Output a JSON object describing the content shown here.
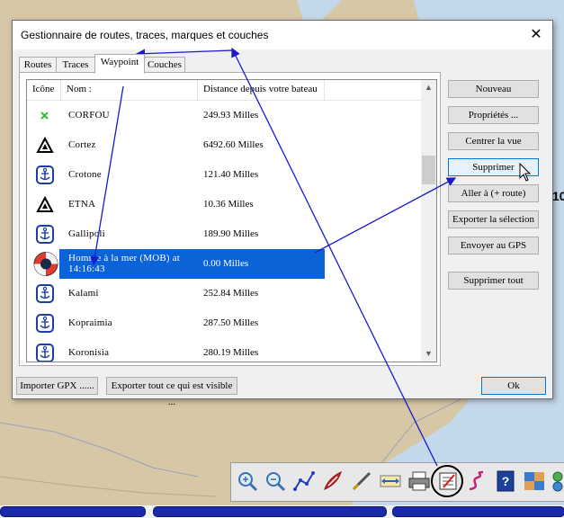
{
  "dialog": {
    "title": "Gestionnaire de routes, traces, marques et couches",
    "close_glyph": "✕"
  },
  "tabs": [
    {
      "label": "Routes"
    },
    {
      "label": "Traces"
    },
    {
      "label": "Waypoint",
      "active": true
    },
    {
      "label": "Couches"
    }
  ],
  "table": {
    "columns": [
      "Icône",
      "Nom :",
      "Distance depuis votre bateau"
    ],
    "rows": [
      {
        "icon": "green-cross-icon",
        "name": "CORFOU",
        "distance": "249.93 Milles"
      },
      {
        "icon": "triangle-mark-icon",
        "name": "Cortez",
        "distance": "6492.60 Milles"
      },
      {
        "icon": "anchor-icon",
        "name": "Crotone",
        "distance": "121.40 Milles"
      },
      {
        "icon": "triangle-mark-icon",
        "name": "ETNA",
        "distance": "10.36 Milles"
      },
      {
        "icon": "anchor-icon",
        "name": "Gallipoli",
        "distance": "189.90 Milles"
      },
      {
        "icon": "lifebuoy-icon",
        "name": "Homme à la mer (MOB) at 14:16:43",
        "distance": "0.00 Milles",
        "selected": true
      },
      {
        "icon": "anchor-icon",
        "name": "Kalami",
        "distance": "252.84 Milles"
      },
      {
        "icon": "anchor-icon",
        "name": "Kopraimia",
        "distance": "287.50 Milles"
      },
      {
        "icon": "anchor-icon",
        "name": "Koronisia",
        "distance": "280.19 Milles"
      }
    ]
  },
  "buttons": {
    "nouveau": "Nouveau",
    "proprietes": "Propriétés ...",
    "centrer": "Centrer la vue",
    "supprimer": "Supprimer",
    "aller": "Aller à (+ route)",
    "exporter_selection": "Exporter la sélection",
    "envoyer_gps": "Envoyer au GPS",
    "supprimer_tout": "Supprimer tout",
    "importer_gpx": "Importer GPX ......",
    "exporter_tout": "Exporter tout ce qui est visible ...",
    "ok": "Ok"
  },
  "map": {
    "partial_label": "10"
  },
  "toolbar": {
    "tools": [
      "zoom-in-icon",
      "zoom-out-icon",
      "route-icon",
      "boat-icon",
      "measure-icon",
      "chart-scale-icon",
      "print-icon",
      "route-manager-icon",
      "track-icon",
      "help-icon",
      "chart-quilt-icon",
      "settings-icon"
    ]
  },
  "colors": {
    "selection": "#0a64d7",
    "annotation_arrow": "#1a1ad0",
    "map_land": "#d6c7a6",
    "map_water": "#c4d8ec"
  }
}
